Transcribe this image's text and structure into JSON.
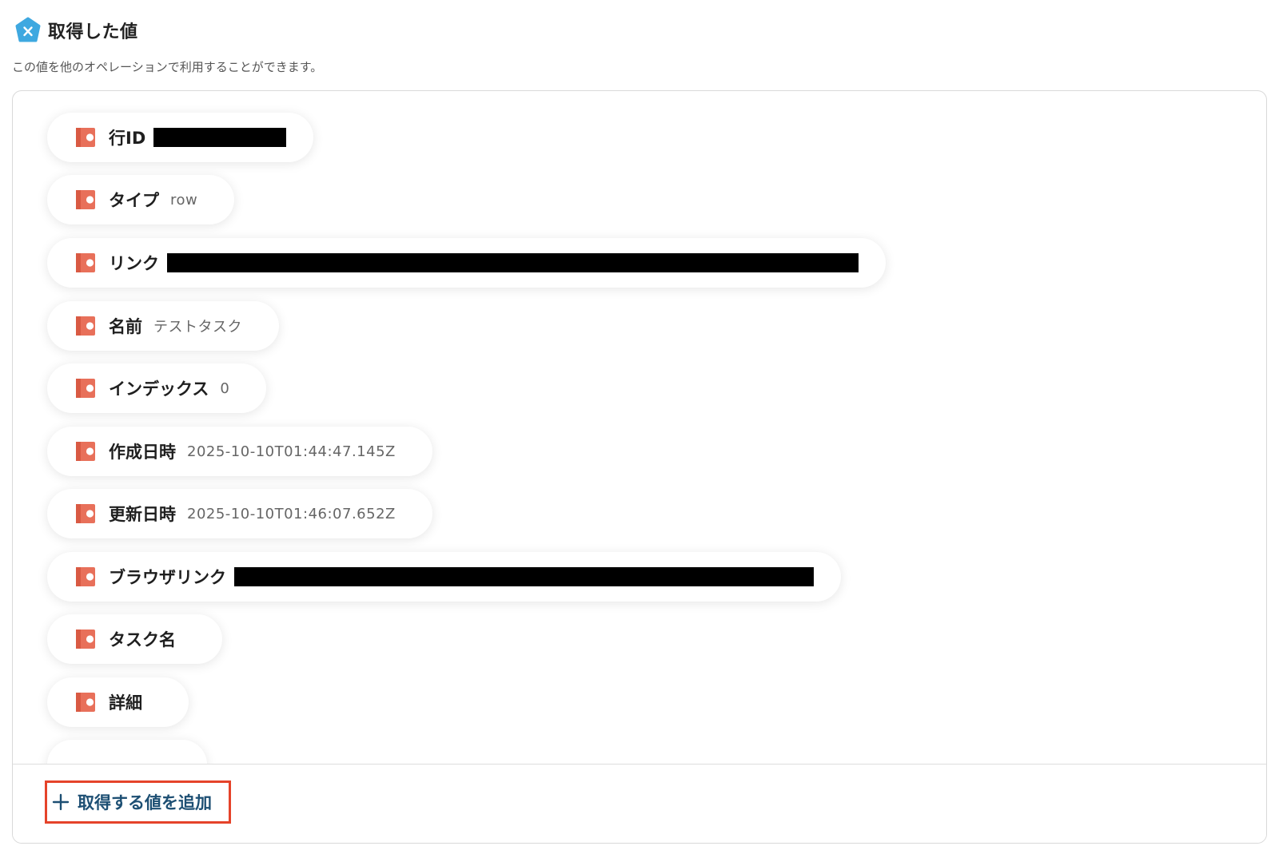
{
  "header": {
    "title": "取得した値",
    "icon": "x-pentagon-icon",
    "icon_color": "#3ea8e0"
  },
  "subtitle": "この値を他のオペレーションで利用することができます。",
  "fields": [
    {
      "label": "行ID",
      "value": "",
      "redacted": true
    },
    {
      "label": "タイプ",
      "value": "row",
      "redacted": false
    },
    {
      "label": "リンク",
      "value": "",
      "redacted": true
    },
    {
      "label": "名前",
      "value": "テストタスク",
      "redacted": false
    },
    {
      "label": "インデックス",
      "value": "0",
      "redacted": false
    },
    {
      "label": "作成日時",
      "value": "2025-10-10T01:44:47.145Z",
      "redacted": false
    },
    {
      "label": "更新日時",
      "value": "2025-10-10T01:46:07.652Z",
      "redacted": false
    },
    {
      "label": "ブラウザリンク",
      "value": "",
      "redacted": true
    },
    {
      "label": "タスク名",
      "value": "",
      "redacted": false
    },
    {
      "label": "詳細",
      "value": "",
      "redacted": false
    }
  ],
  "field_icon": "coda-doc-icon",
  "field_icon_color": "#e8705a",
  "add_button": {
    "label": "取得する値を追加",
    "icon": "plus-icon",
    "color": "#1d4f73",
    "highlight_color": "#e5432a"
  }
}
